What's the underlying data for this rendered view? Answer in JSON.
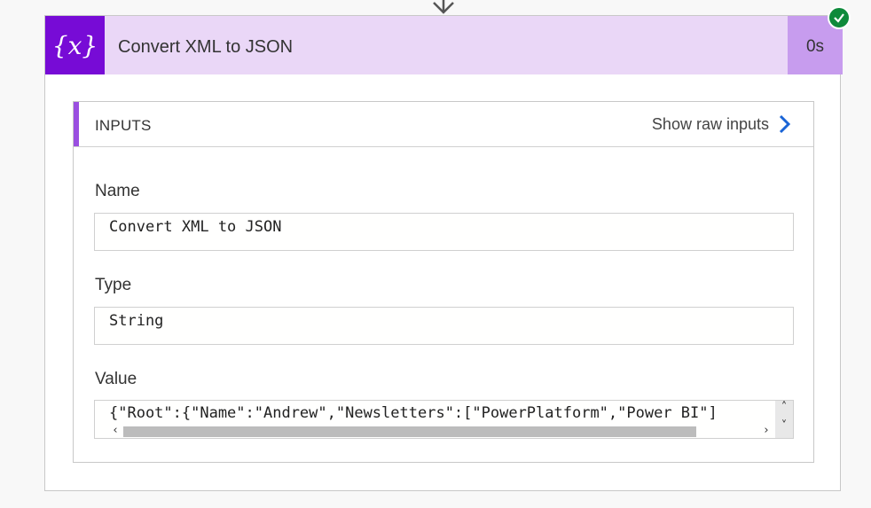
{
  "action": {
    "title": "Convert XML to JSON",
    "duration": "0s",
    "icon": "variable-icon",
    "icon_glyph": "{x}",
    "status": "succeeded",
    "accent_color": "#770bd6",
    "header_color": "#ead7f7",
    "duration_color": "#c79cee",
    "status_color": "#0e8a3b"
  },
  "inputs": {
    "heading": "INPUTS",
    "raw_toggle_label": "Show raw inputs",
    "fields": {
      "name": {
        "label": "Name",
        "value": "Convert XML to JSON"
      },
      "type": {
        "label": "Type",
        "value": "String"
      },
      "value": {
        "label": "Value",
        "value": "{\"Root\":{\"Name\":\"Andrew\",\"Newsletters\":[\"PowerPlatform\",\"Power BI\"]"
      }
    }
  }
}
